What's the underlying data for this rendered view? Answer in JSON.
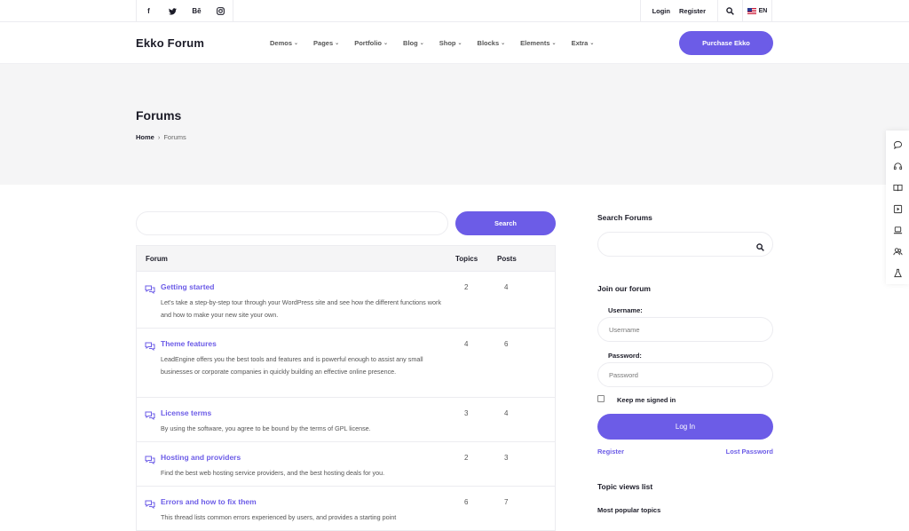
{
  "topbar": {
    "social": [
      {
        "icon": "facebook-icon",
        "glyph": "f"
      },
      {
        "icon": "twitter-icon",
        "glyph": "🐦"
      },
      {
        "icon": "behance-icon",
        "glyph": "Bē"
      },
      {
        "icon": "instagram-icon",
        "glyph": "◎"
      }
    ],
    "login": "Login",
    "register": "Register",
    "lang": "EN"
  },
  "header": {
    "logo": "Ekko Forum",
    "nav": [
      "Demos",
      "Pages",
      "Portfolio",
      "Blog",
      "Shop",
      "Blocks",
      "Elements",
      "Extra"
    ],
    "purchase": "Purchase Ekko"
  },
  "hero": {
    "title": "Forums",
    "breadcrumb_home": "Home",
    "breadcrumb_sep": "›",
    "breadcrumb_current": "Forums"
  },
  "main": {
    "search_button": "Search",
    "table": {
      "headers": {
        "forum": "Forum",
        "topics": "Topics",
        "posts": "Posts"
      },
      "rows": [
        {
          "title": "Getting started",
          "desc": "Let's take a step-by-step tour through your WordPress site and see how the different functions work and how to make your new site your own.",
          "topics": "2",
          "posts": "4"
        },
        {
          "title": "Theme features",
          "desc": "LeadEngine offers you the best tools and features and is powerful enough to assist any small businesses or corporate companies in quickly building an effective online presence.",
          "topics": "4",
          "posts": "6"
        },
        {
          "title": "License terms",
          "desc": "By using the software, you agree to be bound by the terms of GPL license.",
          "topics": "3",
          "posts": "4"
        },
        {
          "title": "Hosting and providers",
          "desc": "Find the best web hosting service providers, and the best hosting deals for you.",
          "topics": "2",
          "posts": "3"
        },
        {
          "title": "Errors and how to fix them",
          "desc": "This thread lists common errors experienced by users, and provides a starting point",
          "topics": "6",
          "posts": "7"
        }
      ]
    }
  },
  "sidebar": {
    "search_title": "Search Forums",
    "join_title": "Join our forum",
    "username_label": "Username:",
    "username_placeholder": "Username",
    "password_label": "Password:",
    "password_placeholder": "Password",
    "keep_signed": "Keep me signed in",
    "login_button": "Log In",
    "register_link": "Register",
    "lost_password": "Lost Password",
    "topic_views_title": "Topic views list",
    "most_popular": "Most popular topics"
  },
  "colors": {
    "accent": "#6c5ce7",
    "hero_bg": "#f5f5f6"
  }
}
